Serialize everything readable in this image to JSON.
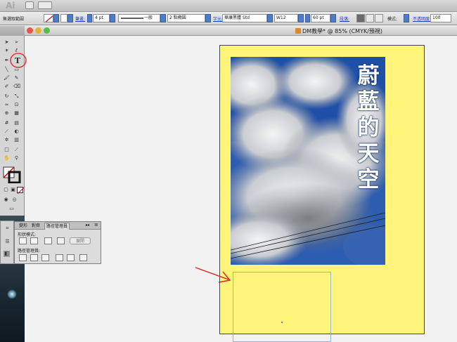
{
  "app": {
    "logo": "Ai"
  },
  "control_bar": {
    "selection_label": "無選取範圍",
    "stroke_label": "筆畫:",
    "stroke_weight": "4 pt",
    "stroke_style": "一般",
    "brush": "2 點橢圓",
    "char_label": "字元:",
    "font_family": "華康黑體 Std",
    "font_style": "W12",
    "font_size": "60 pt",
    "paragraph_label": "段落:",
    "mode_label": "模式:",
    "opacity_label": "不透明度:",
    "opacity_value": "100"
  },
  "document": {
    "title": "DM教學* @ 85% (CMYK/預視)"
  },
  "panel": {
    "tabs": [
      "變形",
      "對齊",
      "路徑管理員"
    ],
    "shape_modes_label": "形狀模式:",
    "expand_label": "展開",
    "pathfinders_label": "路徑管理員:"
  },
  "artwork": {
    "title_text": "蔚藍的天空"
  },
  "colors": {
    "artboard": "#fff57a",
    "sky": "#2f5aa8",
    "arrow": "#e02020",
    "highlight_circle": "#e23a3a"
  }
}
